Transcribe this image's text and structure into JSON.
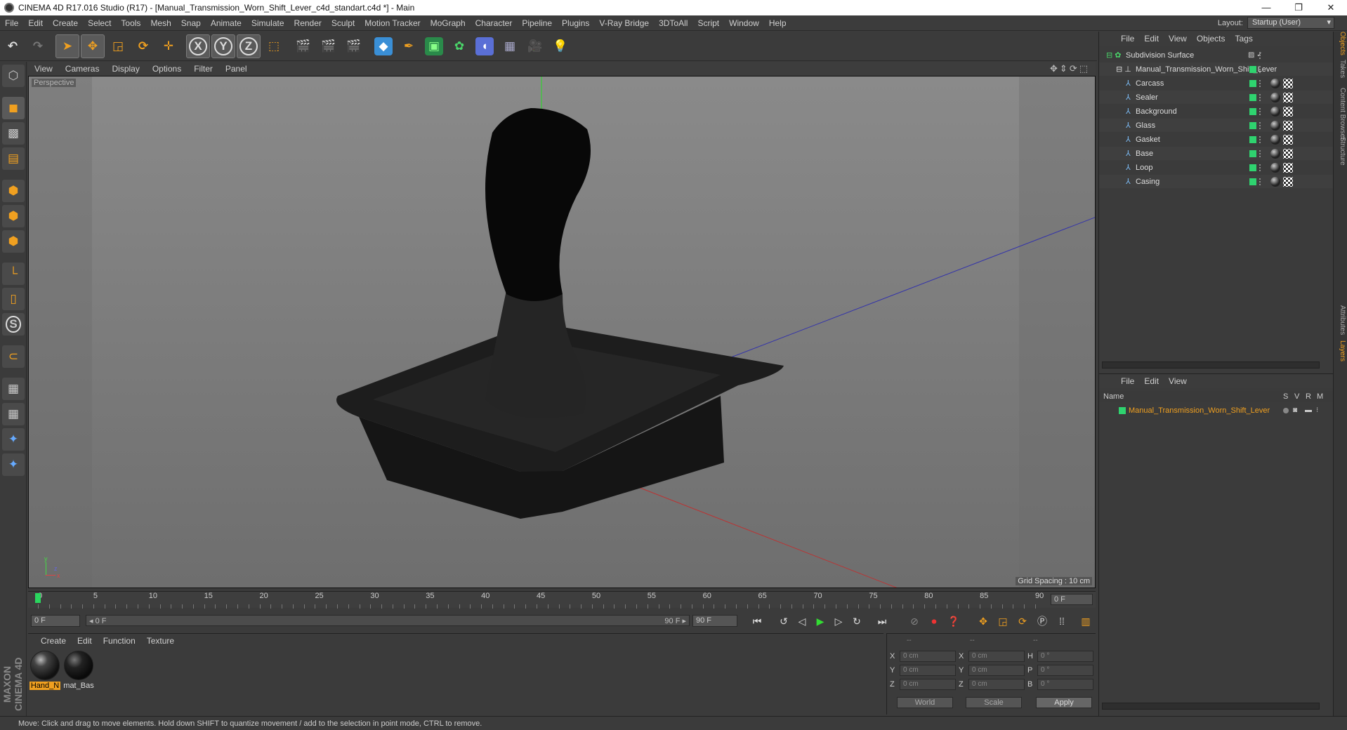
{
  "window": {
    "title": "CINEMA 4D R17.016 Studio (R17) - [Manual_Transmission_Worn_Shift_Lever_c4d_standart.c4d *] - Main",
    "min": "—",
    "restore": "❐",
    "close": "✕"
  },
  "menu": [
    "File",
    "Edit",
    "Create",
    "Select",
    "Tools",
    "Mesh",
    "Snap",
    "Animate",
    "Simulate",
    "Render",
    "Sculpt",
    "Motion Tracker",
    "MoGraph",
    "Character",
    "Pipeline",
    "Plugins",
    "V-Ray Bridge",
    "3DToAll",
    "Script",
    "Window",
    "Help"
  ],
  "layout": {
    "label": "Layout:",
    "value": "Startup (User)"
  },
  "viewport": {
    "menu": [
      "View",
      "Cameras",
      "Display",
      "Options",
      "Filter",
      "Panel"
    ],
    "camera": "Perspective",
    "grid_spacing": "Grid Spacing : 10 cm",
    "axis_labels": {
      "x": "x",
      "y": "y",
      "z": "z"
    }
  },
  "timeline": {
    "ticks": [
      "0",
      "5",
      "10",
      "15",
      "20",
      "25",
      "30",
      "35",
      "40",
      "45",
      "50",
      "55",
      "60",
      "65",
      "70",
      "75",
      "80",
      "85",
      "90"
    ],
    "current_frame": "0 F",
    "start_field": "0 F",
    "slider_left": "◂ 0 F",
    "slider_right": "90 F ▸",
    "end_field": "90 F"
  },
  "materials": {
    "menu": [
      "Create",
      "Edit",
      "Function",
      "Texture"
    ],
    "items": [
      {
        "label": "Hand_N",
        "selected": true
      },
      {
        "label": "mat_Bas",
        "selected": false
      }
    ]
  },
  "coords": {
    "headers": [
      "--",
      "--",
      "--"
    ],
    "rows": [
      {
        "a": "X",
        "av": "0 cm",
        "b": "X",
        "bv": "0 cm",
        "c": "H",
        "cv": "0 °"
      },
      {
        "a": "Y",
        "av": "0 cm",
        "b": "Y",
        "bv": "0 cm",
        "c": "P",
        "cv": "0 °"
      },
      {
        "a": "Z",
        "av": "0 cm",
        "b": "Z",
        "bv": "0 cm",
        "c": "B",
        "cv": "0 °"
      }
    ],
    "mode1": "World",
    "mode2": "Scale",
    "apply": "Apply"
  },
  "objects": {
    "menu": [
      "File",
      "Edit",
      "View",
      "Objects",
      "Tags"
    ],
    "items": [
      {
        "name": "Subdivision Surface",
        "indent": 0
      },
      {
        "name": "Manual_Transmission_Worn_Shift_Lever",
        "indent": 1
      },
      {
        "name": "Carcass",
        "indent": 2
      },
      {
        "name": "Sealer",
        "indent": 2
      },
      {
        "name": "Background",
        "indent": 2
      },
      {
        "name": "Glass",
        "indent": 2
      },
      {
        "name": "Gasket",
        "indent": 2
      },
      {
        "name": "Base",
        "indent": 2
      },
      {
        "name": "Loop",
        "indent": 2
      },
      {
        "name": "Casing",
        "indent": 2
      }
    ]
  },
  "layers": {
    "menu": [
      "File",
      "Edit",
      "View"
    ],
    "headers": {
      "name": "Name",
      "s": "S",
      "v": "V",
      "r": "R",
      "m": "M"
    },
    "rows": [
      {
        "name": "Manual_Transmission_Worn_Shift_Lever"
      }
    ]
  },
  "side_tabs": [
    "Objects",
    "Takes",
    "Content Browser",
    "Structure",
    "Attributes",
    "Layers"
  ],
  "status": "Move: Click and drag to move elements. Hold down SHIFT to quantize movement / add to the selection in point mode, CTRL to remove.",
  "brand": "MAXON CINEMA 4D",
  "colors": {
    "accent": "#f0a020",
    "green": "#2fd36f",
    "bg": "#3b3b3b"
  }
}
